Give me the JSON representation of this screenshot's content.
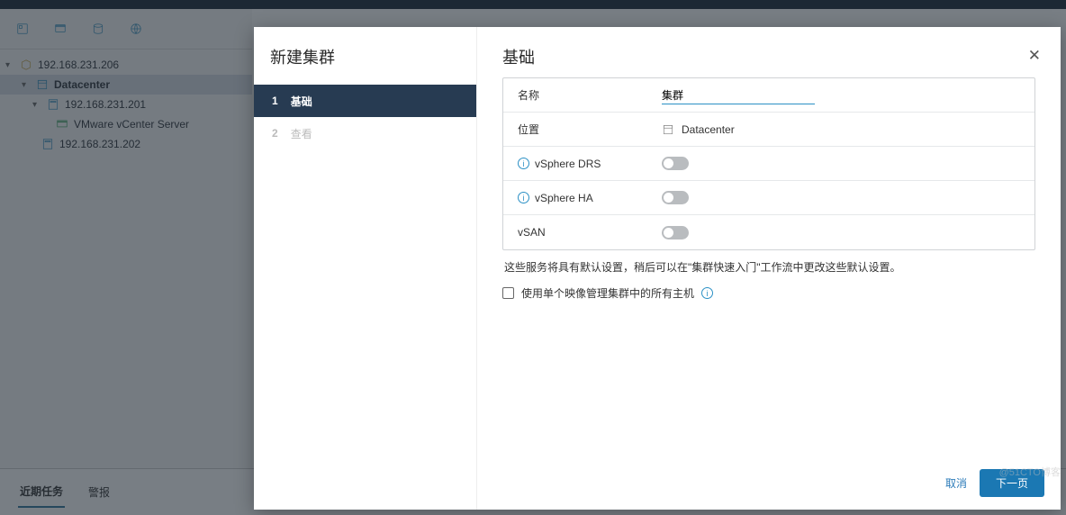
{
  "tree": {
    "root_ip": "192.168.231.206",
    "datacenter": "Datacenter",
    "host1_ip": "192.168.231.201",
    "vcenter_label": "VMware vCenter Server",
    "host2_ip": "192.168.231.202"
  },
  "bottom_tabs": {
    "recent_tasks": "近期任务",
    "alarms": "警报"
  },
  "wizard": {
    "title": "新建集群",
    "steps": {
      "s1_num": "1",
      "s1_label": "基础",
      "s2_num": "2",
      "s2_label": "查看"
    }
  },
  "form": {
    "section_title": "基础",
    "name_label": "名称",
    "name_value": "集群",
    "location_label": "位置",
    "location_value": "Datacenter",
    "drs_label": "vSphere DRS",
    "ha_label": "vSphere HA",
    "vsan_label": "vSAN"
  },
  "helper_text": "这些服务将具有默认设置，稍后可以在\"集群快速入门\"工作流中更改这些默认设置。",
  "checkbox_label": "使用单个映像管理集群中的所有主机",
  "footer": {
    "cancel": "取消",
    "next": "下一页"
  },
  "watermark": "@51CTO博客"
}
